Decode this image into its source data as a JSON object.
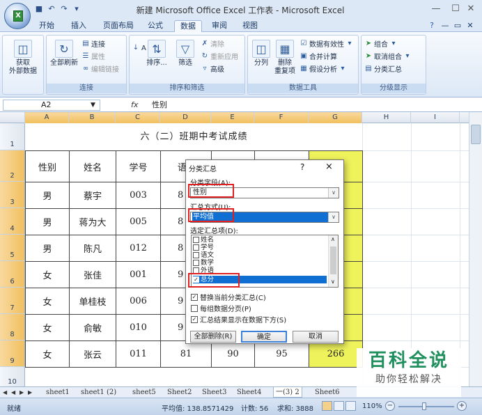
{
  "window": {
    "title": "新建 Microsoft Office Excel 工作表 - Microsoft Excel",
    "office_button": "X"
  },
  "tabs": [
    "开始",
    "插入",
    "页面布局",
    "公式",
    "数据",
    "审阅",
    "视图"
  ],
  "active_tab_index": 4,
  "ribbon": {
    "get_external": "获取\n外部数据",
    "refresh_all": "全部刷新",
    "connections": "连接",
    "properties": "属性",
    "edit_links": "编辑链接",
    "group_connections": "连接",
    "sort_az": "A↓",
    "sort": "排序...",
    "filter": "筛选",
    "clear": "清除",
    "reapply": "重新应用",
    "advanced": "高级",
    "group_sort": "排序和筛选",
    "text_to_columns": "分列",
    "remove_duplicates": "删除\n重复项",
    "data_validation": "数据有效性",
    "consolidate": "合并计算",
    "what_if": "假设分析",
    "group_tools": "数据工具",
    "group_btn": "组合",
    "ungroup_btn": "取消组合",
    "subtotal_btn": "分类汇总",
    "group_outline": "分级显示"
  },
  "formula_bar": {
    "name_box": "A2",
    "fx": "fx",
    "content": "性别"
  },
  "columns": [
    "A",
    "B",
    "C",
    "D",
    "E",
    "F",
    "G",
    "H",
    "I"
  ],
  "rows": [
    "1",
    "2",
    "3",
    "4",
    "5",
    "6",
    "7",
    "8",
    "9",
    "10"
  ],
  "sheet": {
    "title": "六（二）班期中考试成绩",
    "header": [
      "性别",
      "姓名",
      "学号",
      "语"
    ],
    "data": [
      [
        "男",
        "蔡宇",
        "003",
        "8"
      ],
      [
        "男",
        "蒋为大",
        "005",
        "8"
      ],
      [
        "男",
        "陈凡",
        "012",
        "8"
      ],
      [
        "女",
        "张佳",
        "001",
        "9"
      ],
      [
        "女",
        "单桂枝",
        "006",
        "9"
      ],
      [
        "女",
        "俞敏",
        "010",
        "9"
      ],
      [
        "女",
        "张云",
        "011",
        "81",
        "90",
        "95",
        "266"
      ]
    ]
  },
  "dialog": {
    "title": "分类汇总",
    "help": "?",
    "close": "×",
    "field_label": "分类字段(A):",
    "field_value": "性别",
    "method_label": "汇总方式(U):",
    "method_value": "平均值",
    "items_label": "选定汇总项(D):",
    "items": [
      {
        "label": "姓名",
        "checked": false
      },
      {
        "label": "学号",
        "checked": false
      },
      {
        "label": "语文",
        "checked": false
      },
      {
        "label": "数学",
        "checked": false
      },
      {
        "label": "外语",
        "checked": false
      },
      {
        "label": "总分",
        "checked": true
      }
    ],
    "options": [
      {
        "label": "替换当前分类汇总(C)",
        "checked": true
      },
      {
        "label": "每组数据分页(P)",
        "checked": false
      },
      {
        "label": "汇总结果显示在数据下方(S)",
        "checked": true
      }
    ],
    "btn_remove_all": "全部删除(R)",
    "btn_ok": "确定",
    "btn_cancel": "取消"
  },
  "sheet_tabs": [
    "sheet1",
    "sheet1 (2)",
    "sheet5",
    "Sheet2",
    "Sheet3",
    "Sheet4",
    "一(3) 2",
    "Sheet6"
  ],
  "active_sheet_index": 6,
  "status": {
    "ready": "就绪",
    "average": "平均值: 138.8571429",
    "count": "计数: 56",
    "sum": "求和: 3888",
    "zoom": "110%"
  },
  "watermark": {
    "line1": "百科全说",
    "line2": "助你轻松解决"
  },
  "colors": {
    "highlight": "#0f6fd2",
    "callout": "#e02020",
    "column_g": "#eef25b",
    "watermark": "#1f8f5d"
  }
}
